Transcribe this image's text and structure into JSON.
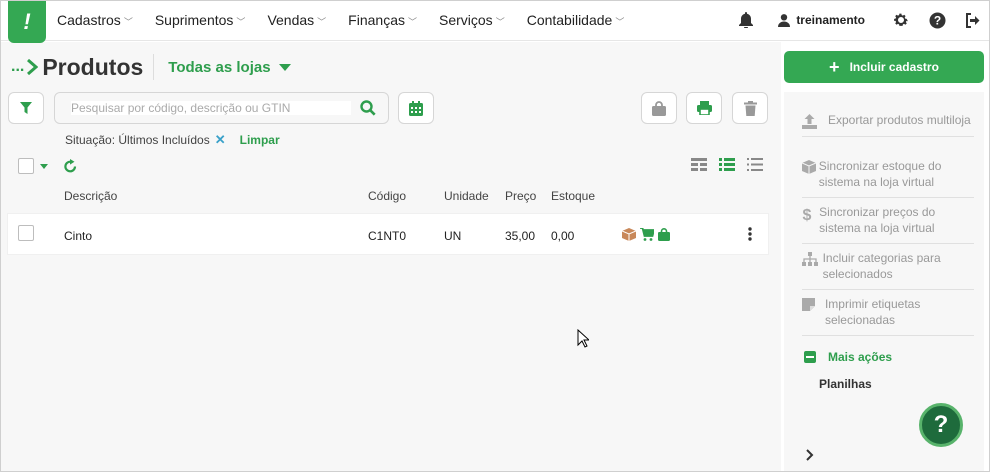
{
  "app": {
    "logo_glyph": "!"
  },
  "nav": {
    "items": [
      {
        "label": "Cadastros"
      },
      {
        "label": "Suprimentos"
      },
      {
        "label": "Vendas"
      },
      {
        "label": "Finanças"
      },
      {
        "label": "Serviços"
      },
      {
        "label": "Contabilidade"
      }
    ],
    "user": "treinamento"
  },
  "header": {
    "breadcrumb": "...",
    "title": "Produtos",
    "store_selector": "Todas as lojas"
  },
  "search": {
    "placeholder": "Pesquisar por código, descrição ou GTIN",
    "value": ""
  },
  "filter": {
    "label": "Situação: Últimos Incluídos",
    "remove_glyph": "✕",
    "clear_label": "Limpar"
  },
  "table": {
    "columns": [
      "Descrição",
      "Código",
      "Unidade",
      "Preço",
      "Estoque"
    ],
    "rows": [
      {
        "descricao": "Cinto",
        "codigo": "C1NT0",
        "unidade": "UN",
        "preco": "35,00",
        "estoque": "0,00"
      }
    ]
  },
  "sidebar": {
    "cta_label": "Incluir cadastro",
    "actions": [
      {
        "label": "Exportar produtos multiloja",
        "icon": "upload-icon"
      },
      {
        "label": "Sincronizar estoque do sistema na loja virtual",
        "icon": "box-icon"
      },
      {
        "label": "Sincronizar preços do sistema na loja virtual",
        "icon": "dollar-icon"
      },
      {
        "label": "Incluir categorias para selecionados",
        "icon": "sitemap-icon"
      },
      {
        "label": "Imprimir etiquetas selecionadas",
        "icon": "sticky-note-icon"
      }
    ],
    "more_label": "Mais ações",
    "sheets_label": "Planilhas",
    "help_glyph": "?"
  },
  "colors": {
    "brand_green": "#34a853",
    "link_green": "#2e9e4d",
    "accent_blue": "#3aa1c9"
  }
}
